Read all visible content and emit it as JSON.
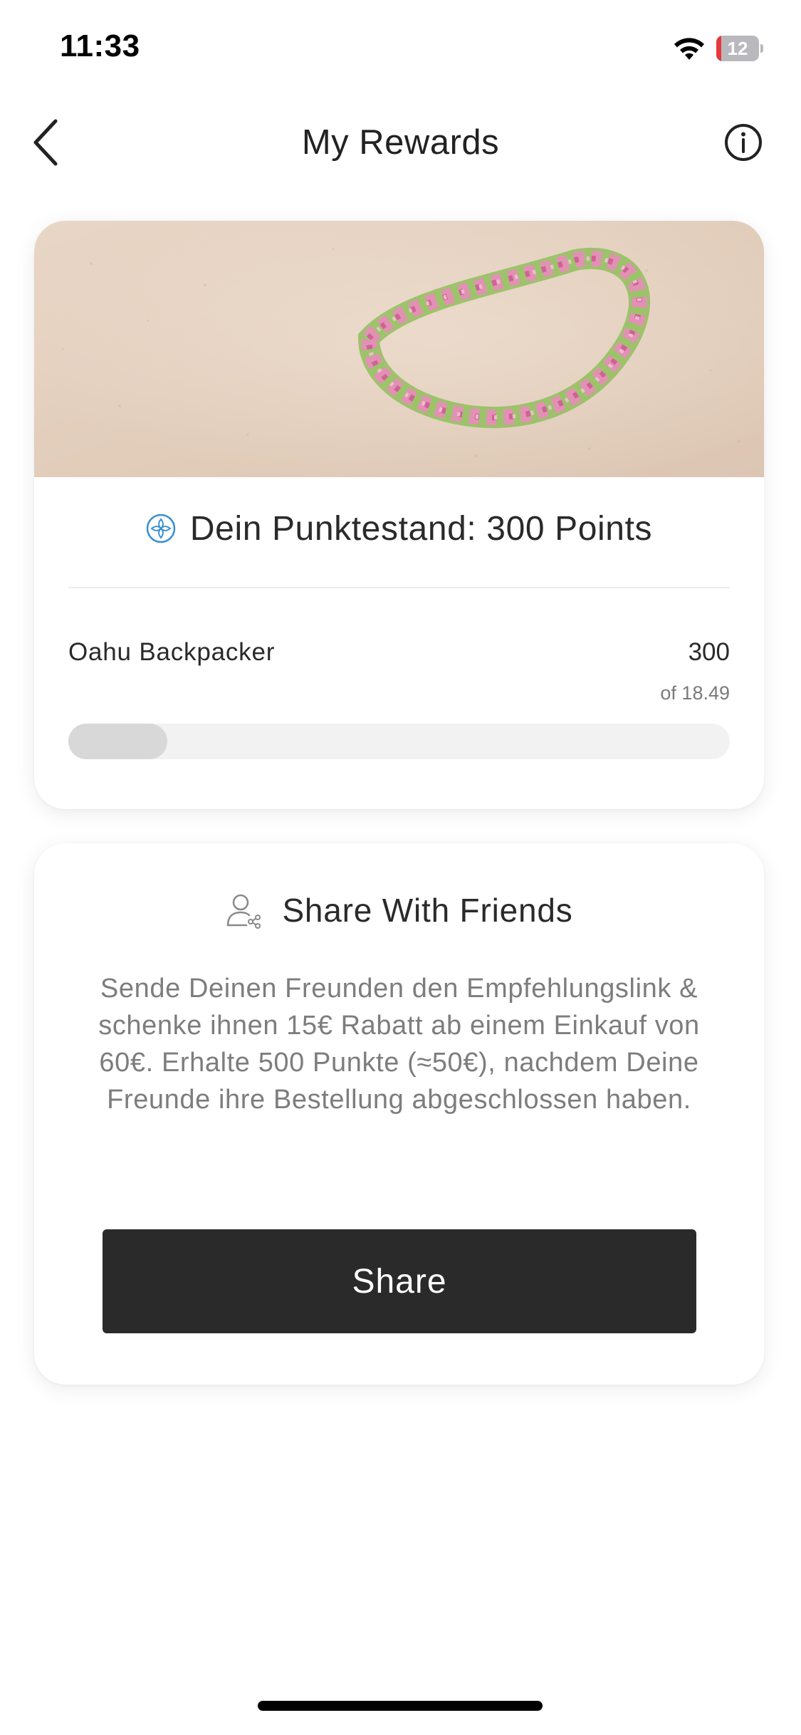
{
  "status_bar": {
    "time": "11:33",
    "battery_level": "12",
    "battery_fraction": 0.12,
    "battery_color": "#e63a3a"
  },
  "nav": {
    "title": "My Rewards",
    "back_icon": "chevron-left-icon",
    "info_icon": "info-circle-icon"
  },
  "points_card": {
    "points_text": "Dein Punktestand: 300 Points",
    "points_icon": "reward-badge-icon",
    "accent_color": "#3a8fcf",
    "level_name": "Oahu Backpacker",
    "level_value": "300",
    "level_sub": "of 18.49",
    "progress_fraction": 0.15
  },
  "share_card": {
    "title": "Share With Friends",
    "icon": "share-user-icon",
    "description": "Sende Deinen Freunden den Empfehlungslink & schenke ihnen 15€ Rabatt ab einem Einkauf von 60€. Erhalte 500 Punkte (≈50€), nachdem Deine Freunde ihre Bestellung abgeschlossen haben.",
    "button_label": "Share",
    "button_color": "#2a2a2a"
  }
}
